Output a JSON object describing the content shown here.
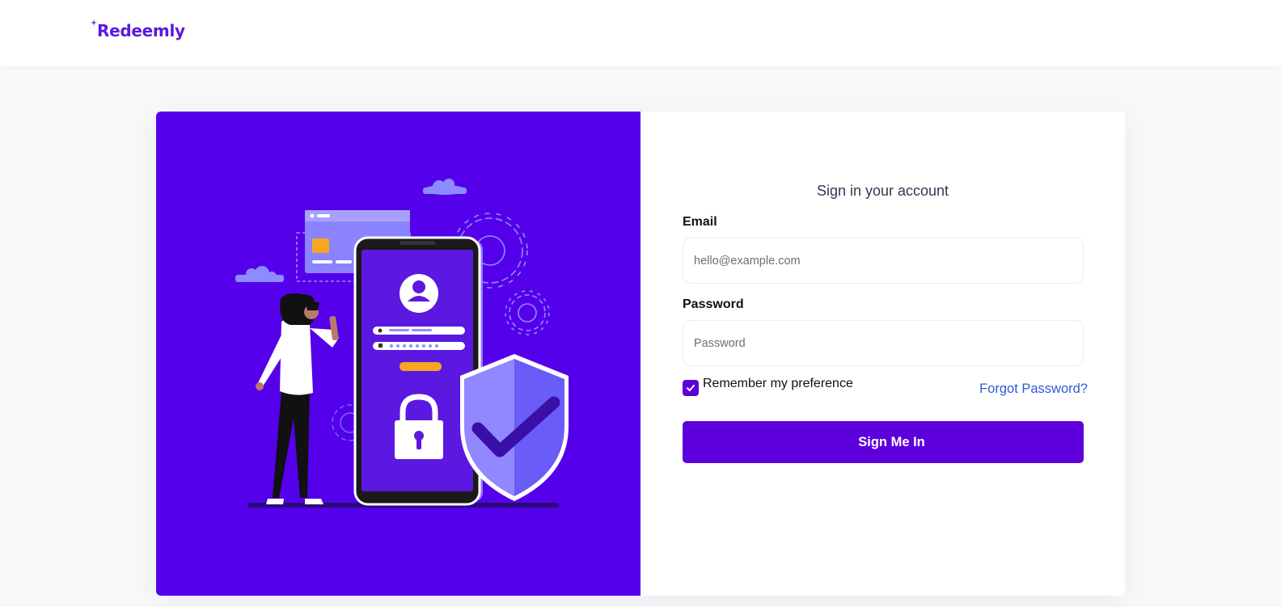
{
  "brand": {
    "name": "Redeemly",
    "color": "#5b1ae0"
  },
  "illustration": {
    "background": "#5500ea",
    "subject": "person-phone-login-shield-illustration"
  },
  "form": {
    "title": "Sign in your account",
    "email_label": "Email",
    "email_placeholder": "hello@example.com",
    "email_value": "",
    "password_label": "Password",
    "password_placeholder": "Password",
    "password_value": "",
    "remember_label": "Remember my preference",
    "remember_checked": true,
    "forgot_label": "Forgot Password?",
    "submit_label": "Sign Me In"
  },
  "colors": {
    "accent": "#5d00dc",
    "link": "#2e5bd8",
    "page_bg": "#f8f8f9"
  }
}
